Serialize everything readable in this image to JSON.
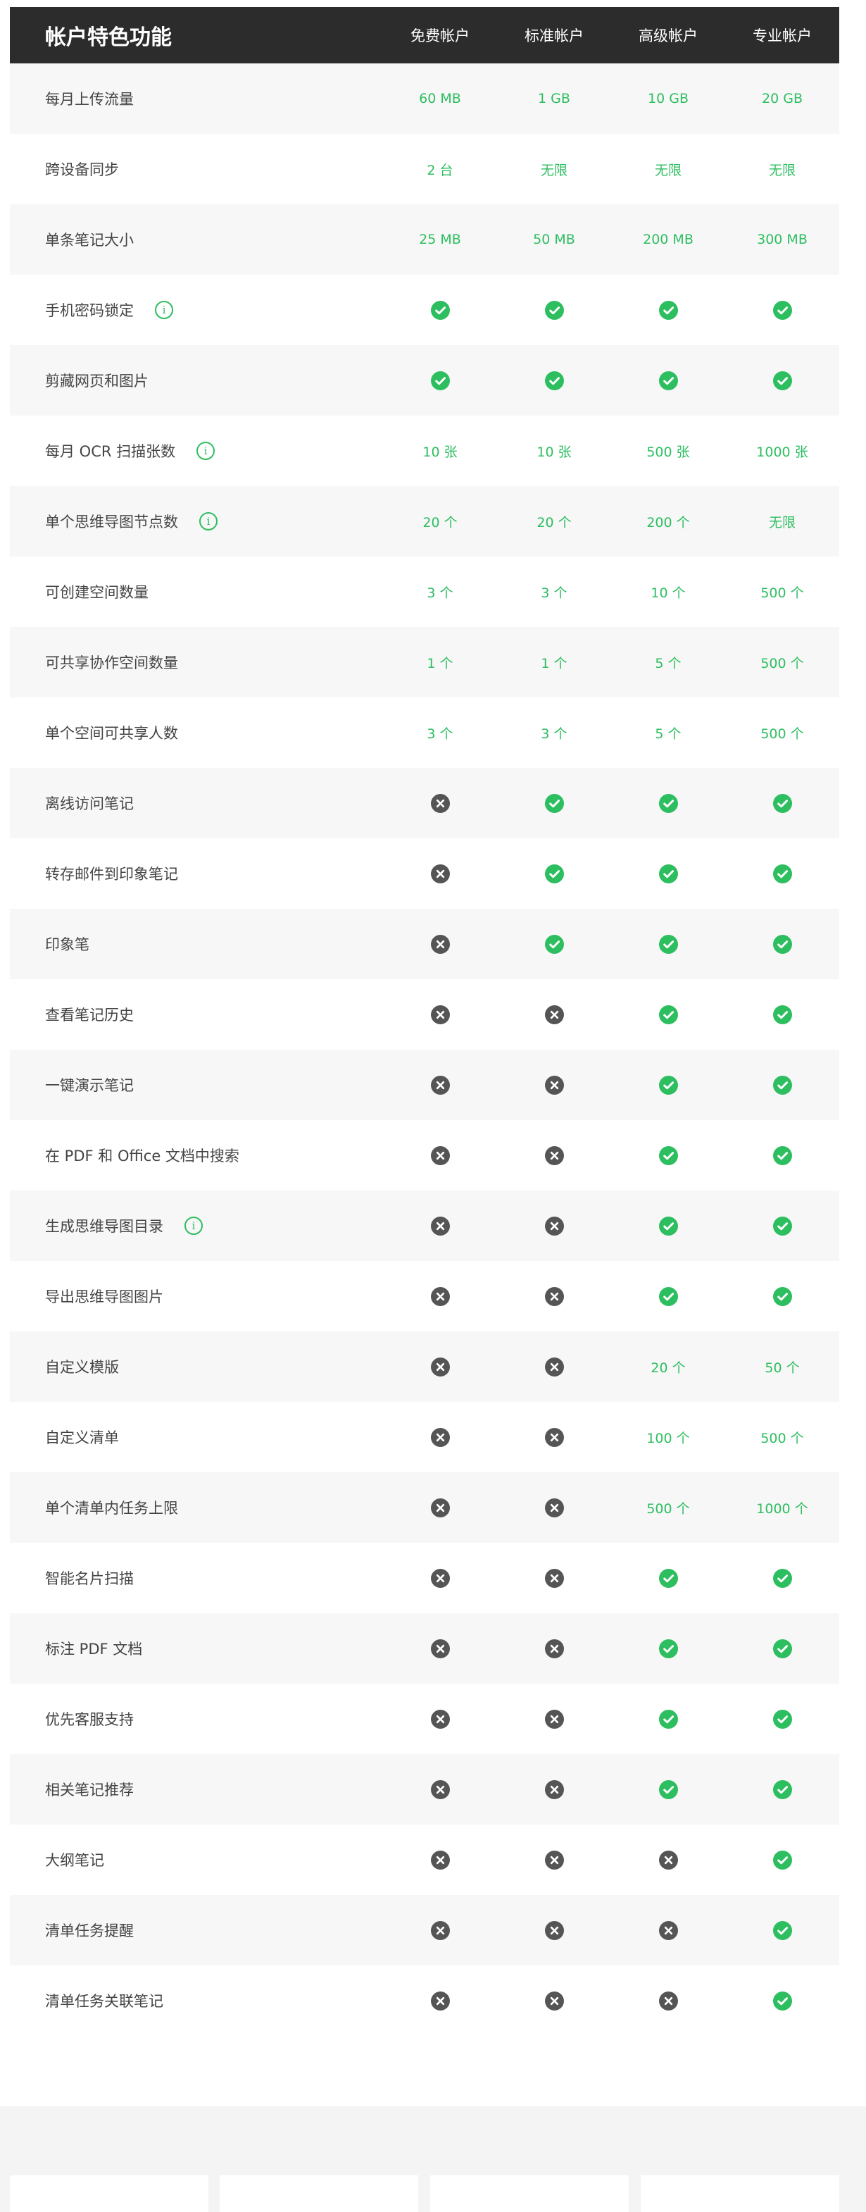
{
  "header": {
    "feature_title": "帐户特色功能",
    "plans": [
      "免费帐户",
      "标准帐户",
      "高级帐户",
      "专业帐户"
    ]
  },
  "icons": {
    "check": "check-circle-icon",
    "cross": "cross-circle-icon",
    "info": "info-icon"
  },
  "colors": {
    "accent": "#2dbe60",
    "cross": "#555555",
    "header_bg": "#2c2c2c"
  },
  "rows": [
    {
      "feature": "每月上传流量",
      "info": false,
      "values": [
        "60 MB",
        "1 GB",
        "10 GB",
        "20 GB"
      ]
    },
    {
      "feature": "跨设备同步",
      "info": false,
      "values": [
        "2 台",
        "无限",
        "无限",
        "无限"
      ]
    },
    {
      "feature": "单条笔记大小",
      "info": false,
      "values": [
        "25 MB",
        "50 MB",
        "200 MB",
        "300 MB"
      ]
    },
    {
      "feature": "手机密码锁定",
      "info": true,
      "values": [
        "check",
        "check",
        "check",
        "check"
      ]
    },
    {
      "feature": "剪藏网页和图片",
      "info": false,
      "values": [
        "check",
        "check",
        "check",
        "check"
      ]
    },
    {
      "feature": "每月 OCR 扫描张数",
      "info": true,
      "values": [
        "10 张",
        "10 张",
        "500 张",
        "1000 张"
      ]
    },
    {
      "feature": "单个思维导图节点数",
      "info": true,
      "values": [
        "20 个",
        "20 个",
        "200 个",
        "无限"
      ]
    },
    {
      "feature": "可创建空间数量",
      "info": false,
      "values": [
        "3 个",
        "3 个",
        "10 个",
        "500 个"
      ]
    },
    {
      "feature": "可共享协作空间数量",
      "info": false,
      "values": [
        "1 个",
        "1 个",
        "5 个",
        "500 个"
      ]
    },
    {
      "feature": "单个空间可共享人数",
      "info": false,
      "values": [
        "3 个",
        "3 个",
        "5 个",
        "500 个"
      ]
    },
    {
      "feature": "离线访问笔记",
      "info": false,
      "values": [
        "cross",
        "check",
        "check",
        "check"
      ]
    },
    {
      "feature": "转存邮件到印象笔记",
      "info": false,
      "values": [
        "cross",
        "check",
        "check",
        "check"
      ]
    },
    {
      "feature": "印象笔",
      "info": false,
      "values": [
        "cross",
        "check",
        "check",
        "check"
      ]
    },
    {
      "feature": "查看笔记历史",
      "info": false,
      "values": [
        "cross",
        "cross",
        "check",
        "check"
      ]
    },
    {
      "feature": "一键演示笔记",
      "info": false,
      "values": [
        "cross",
        "cross",
        "check",
        "check"
      ]
    },
    {
      "feature": "在 PDF 和 Office 文档中搜索",
      "info": false,
      "values": [
        "cross",
        "cross",
        "check",
        "check"
      ]
    },
    {
      "feature": "生成思维导图目录",
      "info": true,
      "values": [
        "cross",
        "cross",
        "check",
        "check"
      ]
    },
    {
      "feature": "导出思维导图图片",
      "info": false,
      "values": [
        "cross",
        "cross",
        "check",
        "check"
      ]
    },
    {
      "feature": "自定义模版",
      "info": false,
      "values": [
        "cross",
        "cross",
        "20 个",
        "50 个"
      ]
    },
    {
      "feature": "自定义清单",
      "info": false,
      "values": [
        "cross",
        "cross",
        "100 个",
        "500 个"
      ]
    },
    {
      "feature": "单个清单内任务上限",
      "info": false,
      "values": [
        "cross",
        "cross",
        "500 个",
        "1000 个"
      ]
    },
    {
      "feature": "智能名片扫描",
      "info": false,
      "values": [
        "cross",
        "cross",
        "check",
        "check"
      ]
    },
    {
      "feature": "标注 PDF 文档",
      "info": false,
      "values": [
        "cross",
        "cross",
        "check",
        "check"
      ]
    },
    {
      "feature": "优先客服支持",
      "info": false,
      "values": [
        "cross",
        "cross",
        "check",
        "check"
      ]
    },
    {
      "feature": "相关笔记推荐",
      "info": false,
      "values": [
        "cross",
        "cross",
        "check",
        "check"
      ]
    },
    {
      "feature": "大纲笔记",
      "info": false,
      "values": [
        "cross",
        "cross",
        "cross",
        "check"
      ]
    },
    {
      "feature": "清单任务提醒",
      "info": false,
      "values": [
        "cross",
        "cross",
        "cross",
        "check"
      ]
    },
    {
      "feature": "清单任务关联笔记",
      "info": false,
      "values": [
        "cross",
        "cross",
        "cross",
        "check"
      ]
    }
  ]
}
